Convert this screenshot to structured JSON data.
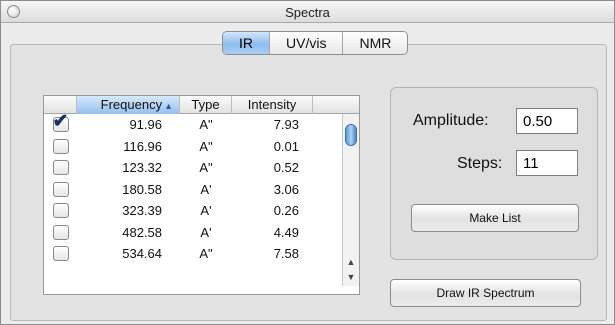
{
  "window": {
    "title": "Spectra"
  },
  "tabs": [
    {
      "label": "IR",
      "active": true
    },
    {
      "label": "UV/vis",
      "active": false
    },
    {
      "label": "NMR",
      "active": false
    }
  ],
  "table": {
    "columns": {
      "check": "",
      "frequency": "Frequency",
      "type": "Type",
      "intensity": "Intensity"
    },
    "sort_icon": "triangle-up-icon",
    "rows": [
      {
        "checked": true,
        "frequency": "91.96",
        "type": "A\"",
        "intensity": "7.93"
      },
      {
        "checked": false,
        "frequency": "116.96",
        "type": "A\"",
        "intensity": "0.01"
      },
      {
        "checked": false,
        "frequency": "123.32",
        "type": "A\"",
        "intensity": "0.52"
      },
      {
        "checked": false,
        "frequency": "180.58",
        "type": "A'",
        "intensity": "3.06"
      },
      {
        "checked": false,
        "frequency": "323.39",
        "type": "A'",
        "intensity": "0.26"
      },
      {
        "checked": false,
        "frequency": "482.58",
        "type": "A'",
        "intensity": "4.49"
      },
      {
        "checked": false,
        "frequency": "534.64",
        "type": "A\"",
        "intensity": "7.58"
      }
    ]
  },
  "settings": {
    "amplitude_label": "Amplitude:",
    "amplitude_value": "0.50",
    "steps_label": "Steps:",
    "steps_value": "11",
    "make_list_label": "Make List"
  },
  "draw_button_label": "Draw IR Spectrum",
  "colors": {
    "accent": "#8fbcef",
    "checkmark": "#1a2f66"
  }
}
